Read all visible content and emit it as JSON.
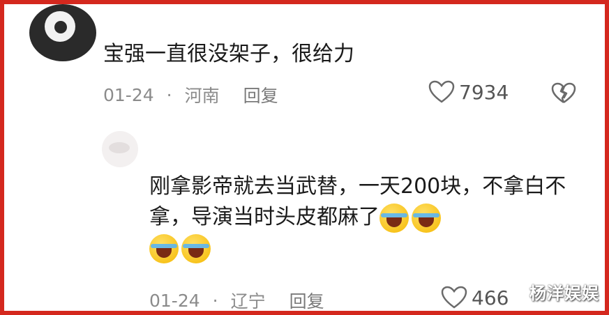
{
  "comment1": {
    "username": "",
    "text": "宝强一直很没架子，很给力",
    "date": "01-24",
    "separator": "·",
    "location": "河南",
    "reply_label": "回复",
    "likes": "7934"
  },
  "comment2": {
    "username": "",
    "text": "刚拿影帝就去当武替，一天200块，不拿白不拿，导演当时头皮都麻了",
    "date": "01-24",
    "separator": "·",
    "location": "辽宁",
    "reply_label": "回复",
    "likes": "466"
  },
  "watermark": "杨洋娱娱",
  "icons": {
    "like": "heart-icon",
    "dislike": "broken-heart-icon",
    "emoji": "laughing-crying-emoji"
  },
  "colors": {
    "frame": "#d4281e",
    "meta_text": "#8b8b8b"
  }
}
